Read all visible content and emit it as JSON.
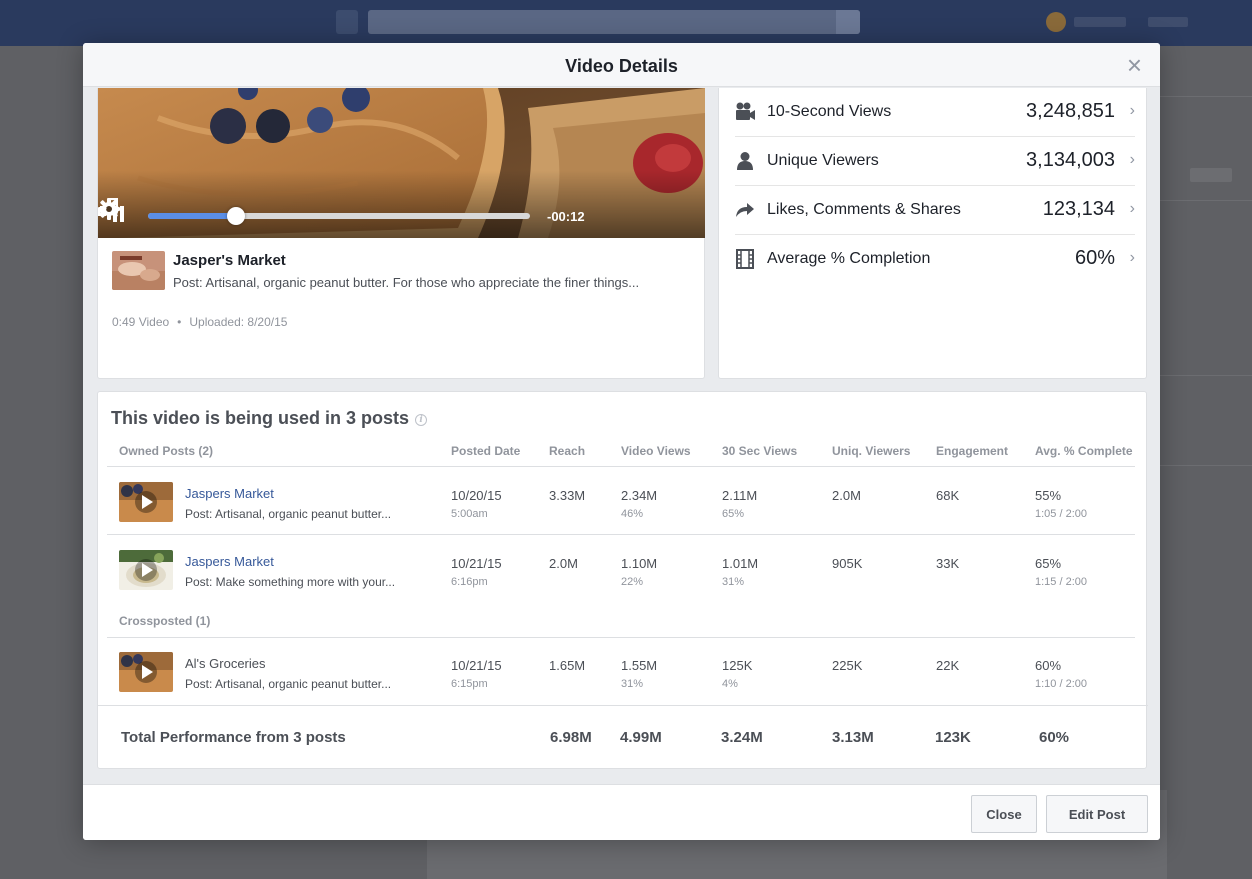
{
  "modal": {
    "title": "Video Details",
    "close_glyph": "×"
  },
  "player": {
    "time_remaining": "-00:12",
    "progress_fraction": 0.23
  },
  "video_info": {
    "page_name": "Jasper's Market",
    "post_text": "Post: Artisanal, organic peanut butter. For those who appreciate the finer things...",
    "duration": "0:49 Video",
    "separator": "•",
    "uploaded": "Uploaded: 8/20/15"
  },
  "stats": [
    {
      "icon": "video-camera-icon",
      "label": "10-Second Views",
      "value": "3,248,851",
      "chevron": "›"
    },
    {
      "icon": "person-icon",
      "label": "Unique Viewers",
      "value": "3,134,003",
      "chevron": "›"
    },
    {
      "icon": "share-arrow-icon",
      "label": "Likes, Comments & Shares",
      "value": "123,134",
      "chevron": "›"
    },
    {
      "icon": "film-strip-icon",
      "label": "Average % Completion",
      "value": "60%",
      "chevron": "›"
    }
  ],
  "posts": {
    "title": "This video is being used in 3 posts",
    "info_glyph": "i",
    "headers": {
      "owned": "Owned Posts (2)",
      "posted_date": "Posted Date",
      "reach": "Reach",
      "video_views": "Video Views",
      "sec30_views": "30 Sec Views",
      "uniq_viewers": "Uniq. Viewers",
      "engagement": "Engagement",
      "avg_complete": "Avg. % Complete"
    },
    "crossposted_label": "Crossposted (1)",
    "rows": [
      {
        "name": "Jaspers Market",
        "post": "Post: Artisanal, organic peanut butter...",
        "date": "10/20/15",
        "time": "5:00am",
        "reach": "3.33M",
        "video_views": "2.34M",
        "video_views_pct": "46%",
        "sec30": "2.11M",
        "sec30_pct": "65%",
        "uniq": "2.0M",
        "engagement": "68K",
        "avg": "55%",
        "avg_time": "1:05 / 2:00"
      },
      {
        "name": "Jaspers Market",
        "post": "Post: Make something more with your...",
        "date": "10/21/15",
        "time": "6:16pm",
        "reach": "2.0M",
        "video_views": "1.10M",
        "video_views_pct": "22%",
        "sec30": "1.01M",
        "sec30_pct": "31%",
        "uniq": "905K",
        "engagement": "33K",
        "avg": "65%",
        "avg_time": "1:15 / 2:00"
      },
      {
        "name": "Al's Groceries",
        "post": "Post: Artisanal, organic peanut butter...",
        "date": "10/21/15",
        "time": "6:15pm",
        "reach": "1.65M",
        "video_views": "1.55M",
        "video_views_pct": "31%",
        "sec30": "125K",
        "sec30_pct": "4%",
        "uniq": "225K",
        "engagement": "22K",
        "avg": "60%",
        "avg_time": "1:10 / 2:00"
      }
    ],
    "total": {
      "label": "Total Performance from 3 posts",
      "reach": "6.98M",
      "video_views": "4.99M",
      "sec30": "3.24M",
      "uniq": "3.13M",
      "engagement": "123K",
      "avg": "60%"
    }
  },
  "footer": {
    "close_label": "Close",
    "edit_label": "Edit Post"
  },
  "colors": {
    "link_blue": "#365899",
    "progress_blue": "#5b8ee6",
    "header_bg": "#f6f7f9",
    "topbar": "#2a3a5e"
  }
}
